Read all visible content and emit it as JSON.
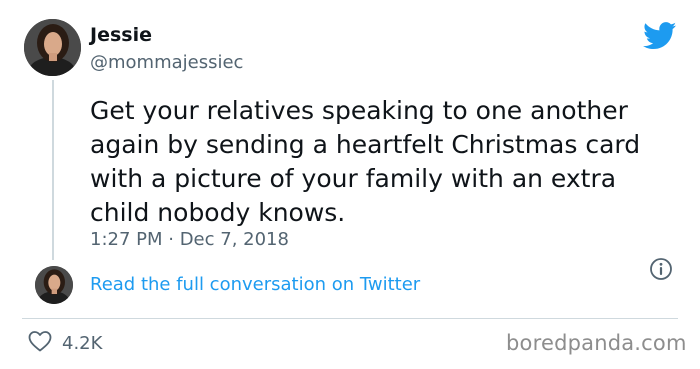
{
  "author": {
    "name": "Jessie",
    "handle": "@mommajessiec"
  },
  "tweet": {
    "lines": [
      "Get your relatives speaking to one another",
      "again by sending a heartfelt Christmas card",
      "with a picture of your family with an extra",
      "child nobody knows."
    ],
    "timestamp": "1:27 PM · Dec 7, 2018"
  },
  "conversation_link": "Read the full conversation on Twitter",
  "likes": "4.2K",
  "watermark": "boredpanda.com",
  "icons": {
    "brand": "twitter-bird-icon",
    "info": "info-icon",
    "like": "heart-icon"
  },
  "colors": {
    "brand_blue": "#1d9bf0",
    "text_primary": "#0f1419",
    "text_secondary": "#536471",
    "divider": "#cfd9de"
  }
}
